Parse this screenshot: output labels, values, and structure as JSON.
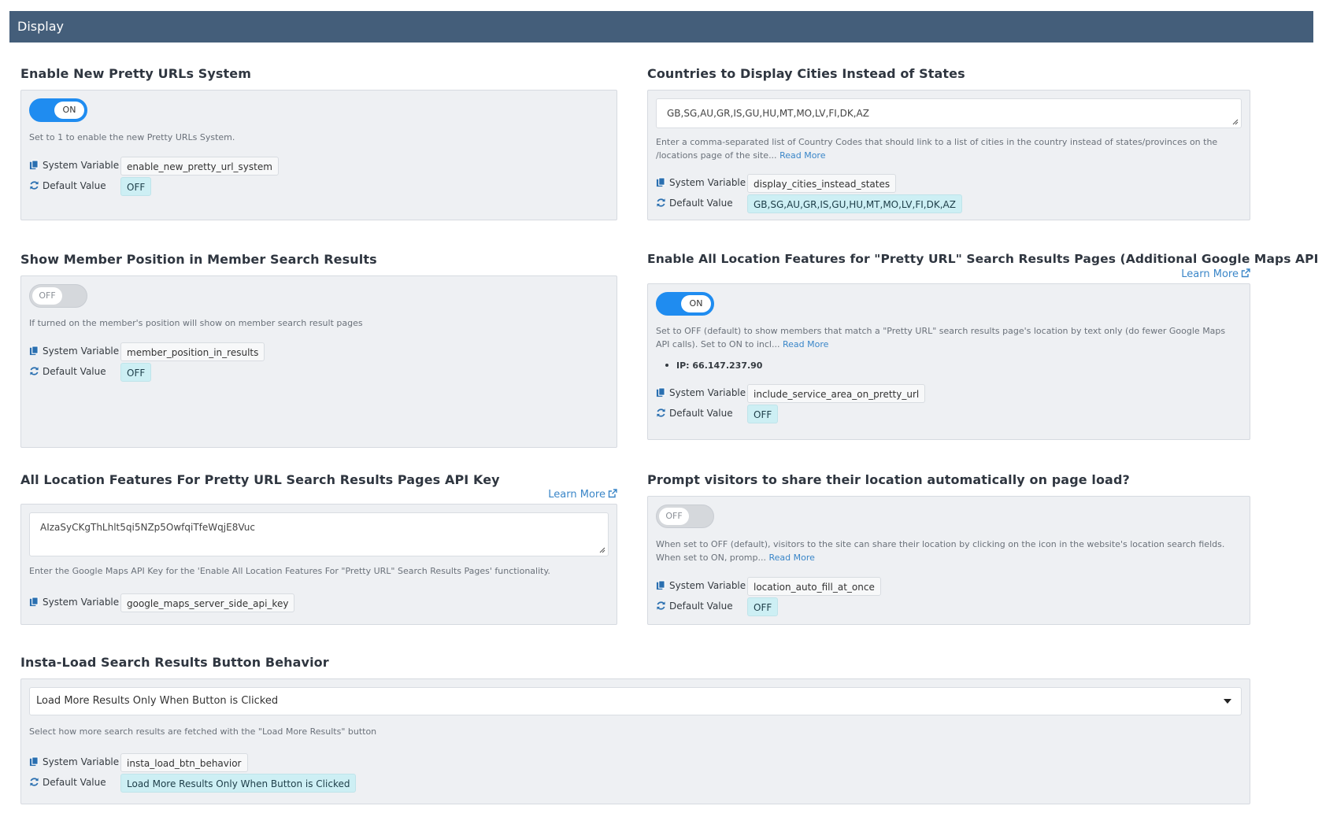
{
  "header": {
    "title": "Display"
  },
  "labels": {
    "system_variable": "System Variable",
    "default_value": "Default Value",
    "learn_more": "Learn More",
    "read_more": "Read More"
  },
  "settings": {
    "pretty_urls": {
      "title": "Enable New Pretty URLs System",
      "toggle": "ON",
      "help": "Set to 1 to enable the new Pretty URLs System.",
      "system_variable": "enable_new_pretty_url_system",
      "default_value": "OFF"
    },
    "countries_cities": {
      "title": "Countries to Display Cities Instead of States",
      "value": "GB,SG,AU,GR,IS,GU,HU,MT,MO,LV,FI,DK,AZ",
      "help": "Enter a comma-separated list of Country Codes that should link to a list of cities in the country instead of states/provinces on the /locations page of the site...",
      "system_variable": "display_cities_instead_states",
      "default_value": "GB,SG,AU,GR,IS,GU,HU,MT,MO,LV,FI,DK,AZ"
    },
    "member_position": {
      "title": "Show Member Position in Member Search Results",
      "toggle": "OFF",
      "help": "If turned on the member's position will show on member search result pages",
      "system_variable": "member_position_in_results",
      "default_value": "OFF"
    },
    "location_features": {
      "title": "Enable All Location Features for \"Pretty URL\" Search Results Pages (Additional Google Maps API Cost)",
      "toggle": "ON",
      "help": "Set to OFF (default) to show members that match a \"Pretty URL\" search results page's location by text only (do fewer Google Maps API calls). Set to ON to incl...",
      "ip": "IP: 66.147.237.90",
      "system_variable": "include_service_area_on_pretty_url",
      "default_value": "OFF"
    },
    "api_key": {
      "title": "All Location Features For Pretty URL Search Results Pages API Key",
      "value": "AIzaSyCKgThLhlt5qi5NZp5OwfqiTfeWqjE8Vuc",
      "help": "Enter the Google Maps API Key for the 'Enable All Location Features For \"Pretty URL\" Search Results Pages' functionality.",
      "system_variable": "google_maps_server_side_api_key"
    },
    "share_location": {
      "title": "Prompt visitors to share their location automatically on page load?",
      "toggle": "OFF",
      "help": "When set to OFF (default), visitors to the site can share their location by clicking on the icon in the website's location search fields.  When set to ON, promp...",
      "system_variable": "location_auto_fill_at_once",
      "default_value": "OFF"
    },
    "insta_load": {
      "title": "Insta-Load Search Results Button Behavior",
      "selected": "Load More Results Only When Button is Clicked",
      "help": "Select how more search results are fetched with the \"Load More Results\" button",
      "system_variable": "insta_load_btn_behavior",
      "default_value": "Load More Results Only When Button is Clicked"
    }
  },
  "colors": {
    "header_bg": "#445e7a",
    "toggle_on": "#1f8cf0",
    "link": "#3a86c8",
    "default_chip_bg": "#cdeff4"
  },
  "icons": [
    "copy-icon",
    "refresh-icon",
    "external-link-icon",
    "resize-grip-icon",
    "chevron-down-icon"
  ]
}
